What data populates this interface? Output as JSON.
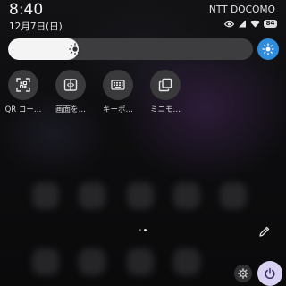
{
  "status_bar": {
    "time": "8:40",
    "carrier": "NTT DOCOMO",
    "date": "12月7日(日)",
    "icons": [
      "eye-icon",
      "signal-icon",
      "wifi-icon",
      "battery-icon"
    ],
    "battery_badge": "84"
  },
  "brightness": {
    "level": 0.29,
    "icon": "sun-icon",
    "auto_button_icon": "auto-brightness-icon",
    "accent_color": "#2f8bdb"
  },
  "quick_tiles": [
    {
      "label": "QR コー…",
      "icon": "qr-scan-icon"
    },
    {
      "label": "画面を…",
      "icon": "split-screen-icon"
    },
    {
      "label": "キーボ…",
      "icon": "keyboard-icon"
    },
    {
      "label": "ミニモ…",
      "icon": "mini-mode-icon"
    }
  ],
  "pager": {
    "pages": 2,
    "active": 1
  },
  "footer": {
    "edit_icon": "pencil-icon",
    "settings_icon": "gear-icon",
    "power_icon": "power-icon",
    "power_color": "#d9d2f3"
  }
}
